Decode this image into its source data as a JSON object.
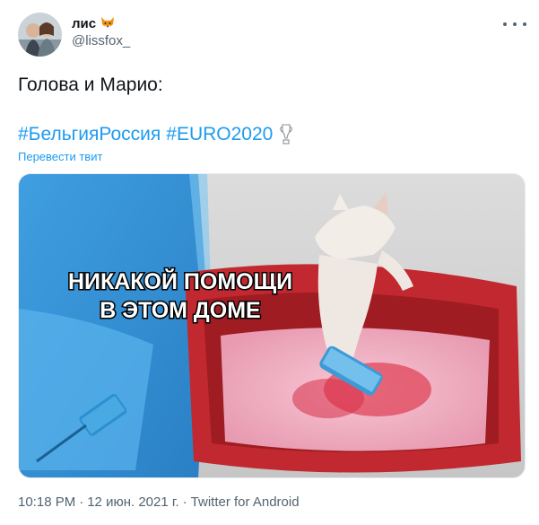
{
  "author": {
    "display_name": "лис",
    "emoji_icon": "fox-face-icon",
    "handle": "@lissfox_"
  },
  "tweet": {
    "text": "Голова и Марио:",
    "hashtags": [
      "#БельгияРоссия",
      "#EURO2020"
    ],
    "trophy_icon": "trophy-icon",
    "translate_label": "Перевести твит",
    "media_caption_line1": "НИКАКОЙ ПОМОЩИ",
    "media_caption_line2": "В ЭТОМ ДОМЕ"
  },
  "footer": {
    "time": "10:18 PM",
    "sep1": "·",
    "date": "12 июн. 2021 г.",
    "sep2": "·",
    "source": "Twitter for Android"
  },
  "colors": {
    "link": "#1d9bf0",
    "secondary_text": "#536471",
    "primary_text": "#0f1419"
  }
}
